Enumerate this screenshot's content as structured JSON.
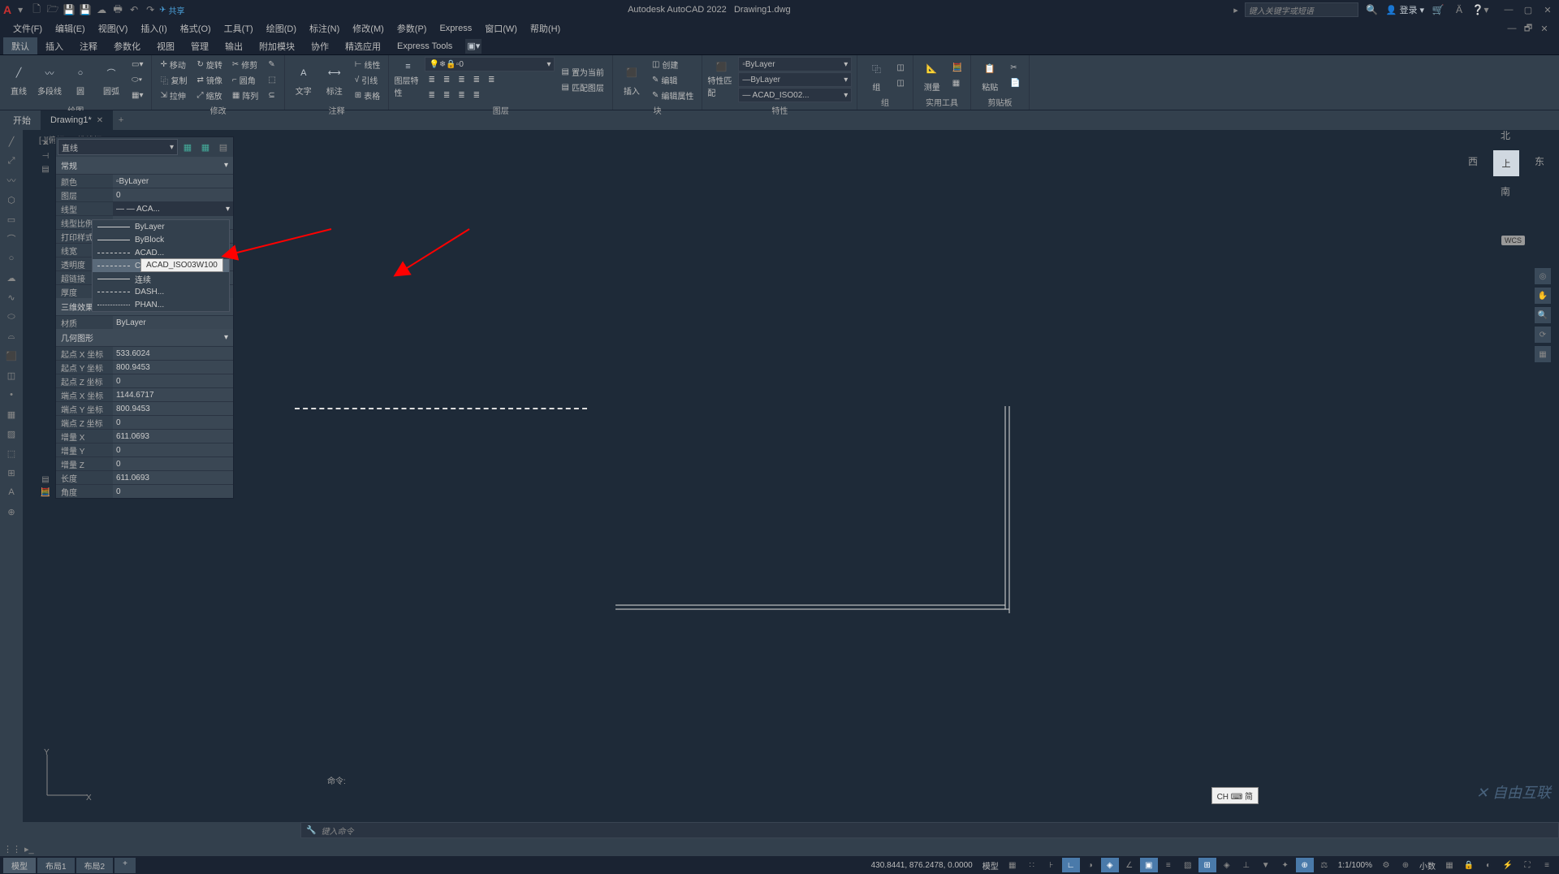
{
  "titlebar": {
    "app_name": "Autodesk AutoCAD 2022",
    "filename": "Drawing1.dwg",
    "share_label": "共享",
    "search_placeholder": "键入关键字或短语",
    "login_label": "登录"
  },
  "menubar": {
    "items": [
      "文件(F)",
      "编辑(E)",
      "视图(V)",
      "插入(I)",
      "格式(O)",
      "工具(T)",
      "绘图(D)",
      "标注(N)",
      "修改(M)",
      "参数(P)",
      "Express",
      "窗口(W)",
      "帮助(H)"
    ]
  },
  "ribbon_tabs": {
    "items": [
      "默认",
      "插入",
      "注释",
      "参数化",
      "视图",
      "管理",
      "输出",
      "附加模块",
      "协作",
      "精选应用",
      "Express Tools"
    ],
    "active": 0
  },
  "ribbon": {
    "draw": {
      "label": "绘图",
      "line": "直线",
      "polyline": "多段线",
      "circle": "圆",
      "arc": "圆弧"
    },
    "modify": {
      "label": "修改",
      "move": "移动",
      "rotate": "旋转",
      "trim": "修剪",
      "copy": "复制",
      "mirror": "镜像",
      "fillet": "圆角",
      "stretch": "拉伸",
      "scale": "缩放",
      "array": "阵列"
    },
    "annotate": {
      "label": "注释",
      "text": "文字",
      "dim": "标注",
      "linear": "线性",
      "leader": "引线",
      "table": "表格"
    },
    "layers": {
      "label": "图层",
      "props": "图层特性",
      "current": "0",
      "setcurrent": "置为当前",
      "match": "匹配图层"
    },
    "block": {
      "label": "块",
      "insert": "插入",
      "create": "创建",
      "edit": "编辑",
      "editattr": "编辑属性"
    },
    "props": {
      "label": "特性",
      "match": "特性匹配",
      "layer_color": "ByLayer",
      "linetype": "ByLayer",
      "acad_iso": "— ACAD_ISO02..."
    },
    "group": {
      "label": "组",
      "group": "组"
    },
    "util": {
      "label": "实用工具",
      "measure": "测量"
    },
    "clipboard": {
      "label": "剪贴板",
      "paste": "粘贴"
    }
  },
  "doc_tabs": {
    "start": "开始",
    "drawing": "Drawing1*"
  },
  "view_label": "[-][俯视][二维线框]",
  "properties": {
    "selector": "直线",
    "sections": {
      "general": "常规",
      "effects3d": "三维效果",
      "geometry": "几何图形"
    },
    "rows": {
      "color": {
        "label": "颜色",
        "value": "ByLayer"
      },
      "layer": {
        "label": "图层",
        "value": "0"
      },
      "linetype": {
        "label": "线型",
        "value": "— — ACA..."
      },
      "ltscale": {
        "label": "线型比例",
        "value": ""
      },
      "plotstyle": {
        "label": "打印样式",
        "value": ""
      },
      "lineweight": {
        "label": "线宽",
        "value": ""
      },
      "transparency": {
        "label": "透明度",
        "value": ""
      },
      "hyperlink": {
        "label": "超链接",
        "value": ""
      },
      "thickness": {
        "label": "厚度",
        "value": ""
      },
      "material": {
        "label": "材质",
        "value": "ByLayer"
      },
      "startx": {
        "label": "起点 X 坐标",
        "value": "533.6024"
      },
      "starty": {
        "label": "起点 Y 坐标",
        "value": "800.9453"
      },
      "startz": {
        "label": "起点 Z 坐标",
        "value": "0"
      },
      "endx": {
        "label": "端点 X 坐标",
        "value": "1144.6717"
      },
      "endy": {
        "label": "端点 Y 坐标",
        "value": "800.9453"
      },
      "endz": {
        "label": "端点 Z 坐标",
        "value": "0"
      },
      "deltax": {
        "label": "增量 X",
        "value": "611.0693"
      },
      "deltay": {
        "label": "增量 Y",
        "value": "0"
      },
      "deltaz": {
        "label": "增量 Z",
        "value": "0"
      },
      "length": {
        "label": "长度",
        "value": "611.0693"
      },
      "angle": {
        "label": "角度",
        "value": "0"
      }
    }
  },
  "linetype_dropdown": {
    "items": [
      {
        "name": "ByLayer",
        "style": "solid"
      },
      {
        "name": "ByBlock",
        "style": "solid"
      },
      {
        "name": "ACAD...",
        "style": "dash"
      },
      {
        "name": "CENTE...",
        "style": "dashdot"
      },
      {
        "name": "连续",
        "style": "solid"
      },
      {
        "name": "DASH...",
        "style": "dash"
      },
      {
        "name": "PHAN...",
        "style": "dashdotdot"
      }
    ],
    "tooltip": "ACAD_ISO03W100"
  },
  "viewcube": {
    "top": "上",
    "north": "北",
    "south": "南",
    "east": "东",
    "west": "西",
    "wcs": "WCS"
  },
  "ime": "CH ⌨ 简",
  "cmdline": {
    "history": "命令:",
    "prompt": "键入命令"
  },
  "statusbar": {
    "model": "模型",
    "layout1": "布局1",
    "layout2": "布局2",
    "coords": "430.8441, 876.2478, 0.0000",
    "model_label": "模型",
    "scale": "1:1/100%",
    "decimal": "小数"
  },
  "watermark": "自由互联",
  "ucs_labels": {
    "x": "X",
    "y": "Y"
  },
  "window_min_icon": "▬"
}
